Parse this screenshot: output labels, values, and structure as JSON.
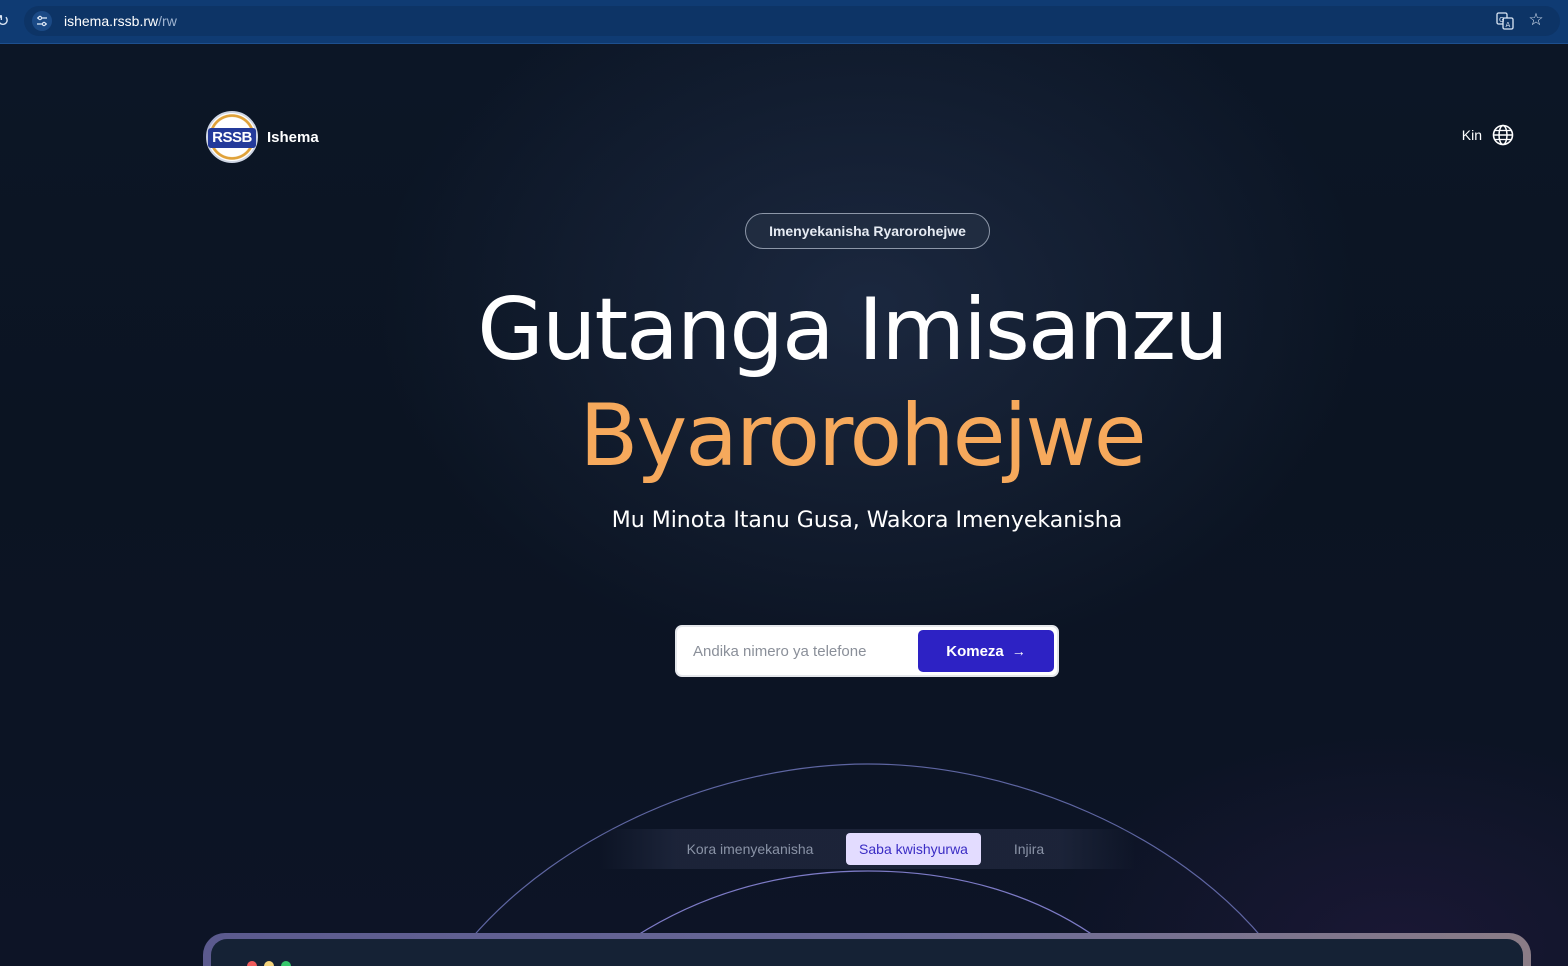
{
  "browser": {
    "url_host": "ishema.rssb.rw",
    "url_path": "/rw"
  },
  "header": {
    "logo_text": "RSSB",
    "brand_name": "Ishema",
    "language_label": "Kin"
  },
  "hero": {
    "badge": "Imenyekanisha Ryarorohejwe",
    "headline_line1": "Gutanga Imisanzu",
    "headline_line2": "Byarorohejwe",
    "subheadline": "Mu Minota Itanu Gusa, Wakora Imenyekanisha"
  },
  "form": {
    "phone_placeholder": "Andika nimero ya telefone",
    "phone_value": "",
    "submit_label": "Komeza"
  },
  "tabs": [
    {
      "label": "Kora imenyekanisha",
      "active": false
    },
    {
      "label": "Saba kwishyurwa",
      "active": true
    },
    {
      "label": "Injira",
      "active": false
    }
  ],
  "colors": {
    "accent_orange": "#f6a95c",
    "primary_button": "#2d22c4",
    "active_tab_bg": "#e3dcff"
  },
  "icons": {
    "reload": "reload-icon",
    "site_info": "tune-icon",
    "translate": "translate-icon",
    "bookmark": "star-icon",
    "language": "globe-icon",
    "submit": "arrow-right-icon"
  }
}
